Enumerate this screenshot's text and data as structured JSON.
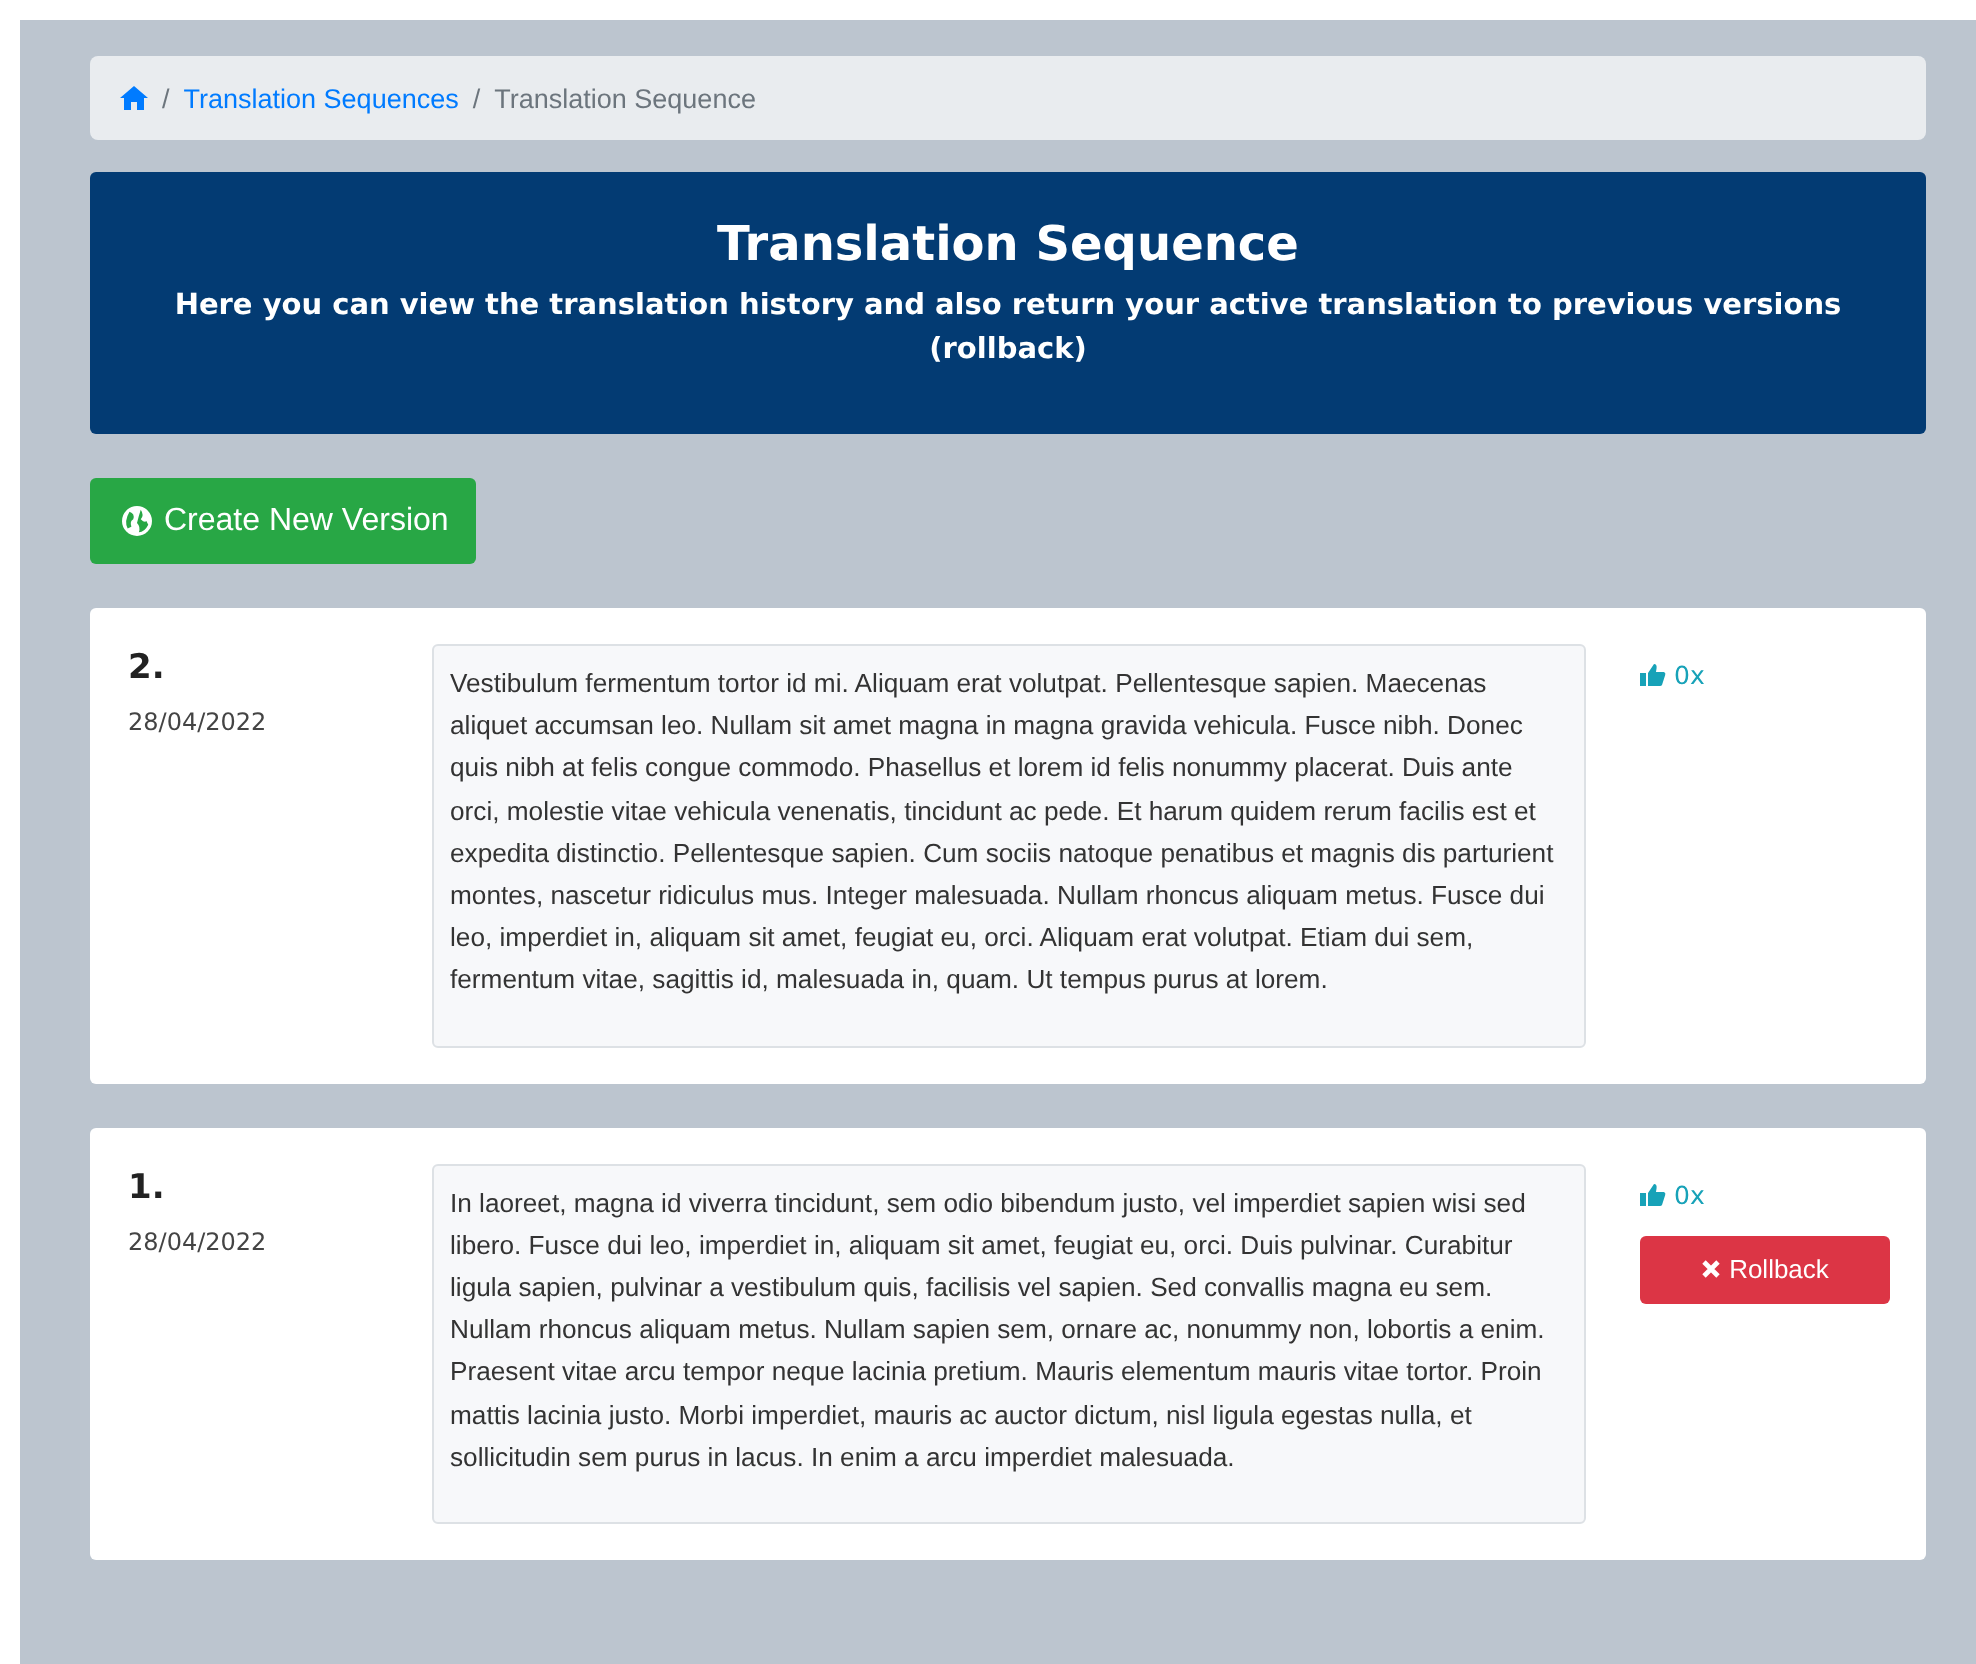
{
  "breadcrumb": {
    "separator": "/",
    "items": [
      {
        "label": "Translation Sequences",
        "kind": "link"
      },
      {
        "label": "Translation Sequence",
        "kind": "current"
      }
    ]
  },
  "header": {
    "title": "Translation Sequence",
    "subtitle": "Here you can view the translation history and also return your active translation to previous versions (rollback)"
  },
  "create_button": {
    "label": "Create New Version"
  },
  "versions": [
    {
      "number": "2.",
      "date": "28/04/2022",
      "text": "Vestibulum fermentum tortor id mi. Aliquam erat volutpat. Pellentesque sapien. Maecenas aliquet accumsan leo. Nullam sit amet magna in magna gravida vehicula. Fusce nibh. Donec quis nibh at felis congue commodo. Phasellus et lorem id felis nonummy placerat. Duis ante orci, molestie vitae vehicula venenatis, tincidunt ac pede. Et harum quidem rerum facilis est et expedita distinctio. Pellentesque sapien. Cum sociis natoque penatibus et magnis dis parturient montes, nascetur ridiculus mus. Integer malesuada. Nullam rhoncus aliquam metus. Fusce dui leo, imperdiet in, aliquam sit amet, feugiat eu, orci. Aliquam erat volutpat. Etiam dui sem, fermentum vitae, sagittis id, malesuada in, quam. Ut tempus purus at lorem.",
      "likes": "0x"
    },
    {
      "number": "1.",
      "date": "28/04/2022",
      "text": "In laoreet, magna id viverra tincidunt, sem odio bibendum justo, vel imperdiet sapien wisi sed libero. Fusce dui leo, imperdiet in, aliquam sit amet, feugiat eu, orci. Duis pulvinar. Curabitur ligula sapien, pulvinar a vestibulum quis, facilisis vel sapien. Sed convallis magna eu sem. Nullam rhoncus aliquam metus. Nullam sapien sem, ornare ac, nonummy non, lobortis a enim. Praesent vitae arcu tempor neque lacinia pretium. Mauris elementum mauris vitae tortor. Proin mattis lacinia justo. Morbi imperdiet, mauris ac auctor dictum, nisl ligula egestas nulla, et sollicitudin sem purus in lacus. In enim a arcu imperdiet malesuada.",
      "likes": "0x",
      "rollback_label": "Rollback"
    }
  ]
}
